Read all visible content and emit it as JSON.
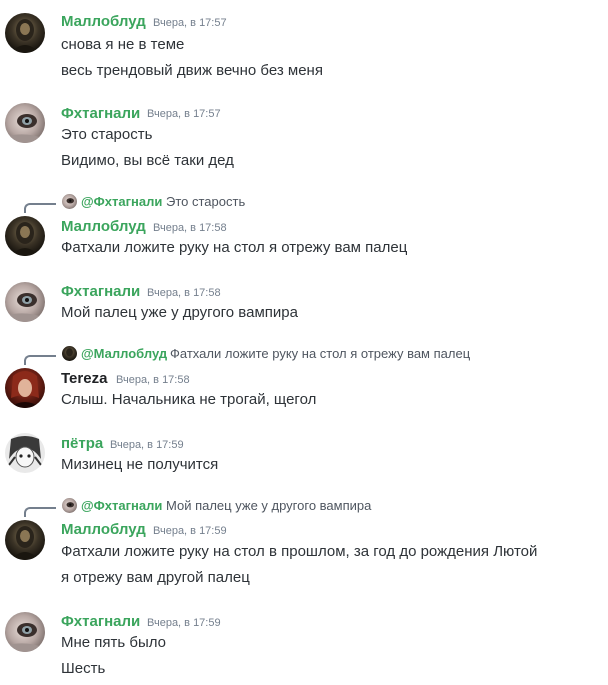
{
  "colors": {
    "green": "#3ba55d",
    "tereza": "#202225",
    "timestamp": "#747f8d",
    "text": "#2e3338",
    "reply_text": "#4f5660"
  },
  "messages": [
    {
      "author": "Маллоблуд",
      "timestamp": "Вчера, в 17:57",
      "lines": [
        "снова я не в теме",
        "весь трендовый движ вечно без меня"
      ]
    },
    {
      "author": "Фхтагнали",
      "timestamp": "Вчера, в 17:57",
      "lines": [
        "Это старость",
        "Видимо, вы всё таки дед"
      ]
    },
    {
      "reply": {
        "author": "@Фхтагнали",
        "text": "Это старость"
      },
      "author": "Маллоблуд",
      "timestamp": "Вчера, в 17:58",
      "lines": [
        "Фатхали ложите руку на стол я отрежу вам палец"
      ]
    },
    {
      "author": "Фхтагнали",
      "timestamp": "Вчера, в 17:58",
      "lines": [
        "Мой палец уже у другого вампира"
      ]
    },
    {
      "reply": {
        "author": "@Маллоблуд",
        "text": "Фатхали ложите руку на стол я отрежу вам палец"
      },
      "author": "Tereza",
      "timestamp": "Вчера, в 17:58",
      "lines": [
        "Слыш. Начальника не трогай, щегол"
      ]
    },
    {
      "author": "пётра",
      "timestamp": "Вчера, в 17:59",
      "lines": [
        "Мизинец не получится"
      ]
    },
    {
      "reply": {
        "author": "@Фхтагнали",
        "text": "Мой палец уже у другого вампира"
      },
      "author": "Маллоблуд",
      "timestamp": "Вчера, в 17:59",
      "lines": [
        "Фатхали ложите руку на стол в прошлом, за год до рождения Лютой",
        "я отрежу вам другой палец"
      ]
    },
    {
      "author": "Фхтагнали",
      "timestamp": "Вчера, в 17:59",
      "lines": [
        "Мне пять было",
        "Шесть"
      ]
    }
  ]
}
